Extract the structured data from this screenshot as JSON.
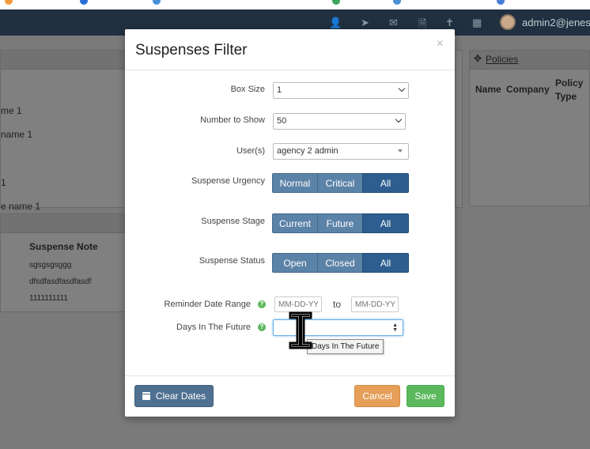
{
  "topbar": {
    "username": "admin2@jenesis",
    "icons": [
      "add-user-icon",
      "paper-plane-icon",
      "envelope-icon",
      "file-icon",
      "utensils-icon",
      "calendar-icon"
    ]
  },
  "background": {
    "left_items": [
      "me 1",
      "name 1",
      "1",
      "e name 1"
    ],
    "suspense_note_header": "Suspense Note",
    "suspense_notes": [
      "sgsgsgsggg",
      "dfsdfasdfasdfasdf",
      "1111111111"
    ],
    "policies_title": "Policies",
    "policies_columns": [
      "Name",
      "Company",
      "Policy Type"
    ]
  },
  "modal": {
    "title": "Suspenses Filter",
    "close": "×",
    "box_size": {
      "label": "Box Size",
      "value": "1"
    },
    "number_to_show": {
      "label": "Number to Show",
      "value": "50"
    },
    "users": {
      "label": "User(s)",
      "value": "agency 2 admin"
    },
    "urgency": {
      "label": "Suspense Urgency",
      "options": [
        "Normal",
        "Critical",
        "All"
      ],
      "selected": "All"
    },
    "stage": {
      "label": "Suspense Stage",
      "options": [
        "Current",
        "Future",
        "All"
      ],
      "selected": "All"
    },
    "status": {
      "label": "Suspense Status",
      "options": [
        "Open",
        "Closed",
        "All"
      ],
      "selected": "All"
    },
    "reminder": {
      "label": "Reminder Date Range",
      "from_placeholder": "MM-DD-YY",
      "to_label": "to",
      "to_placeholder": "MM-DD-YY"
    },
    "days_future": {
      "label": "Days In The Future",
      "value": "",
      "tooltip": "Days In The Future"
    },
    "help_glyph": "?",
    "buttons": {
      "clear": "Clear Dates",
      "cancel": "Cancel",
      "save": "Save"
    }
  }
}
